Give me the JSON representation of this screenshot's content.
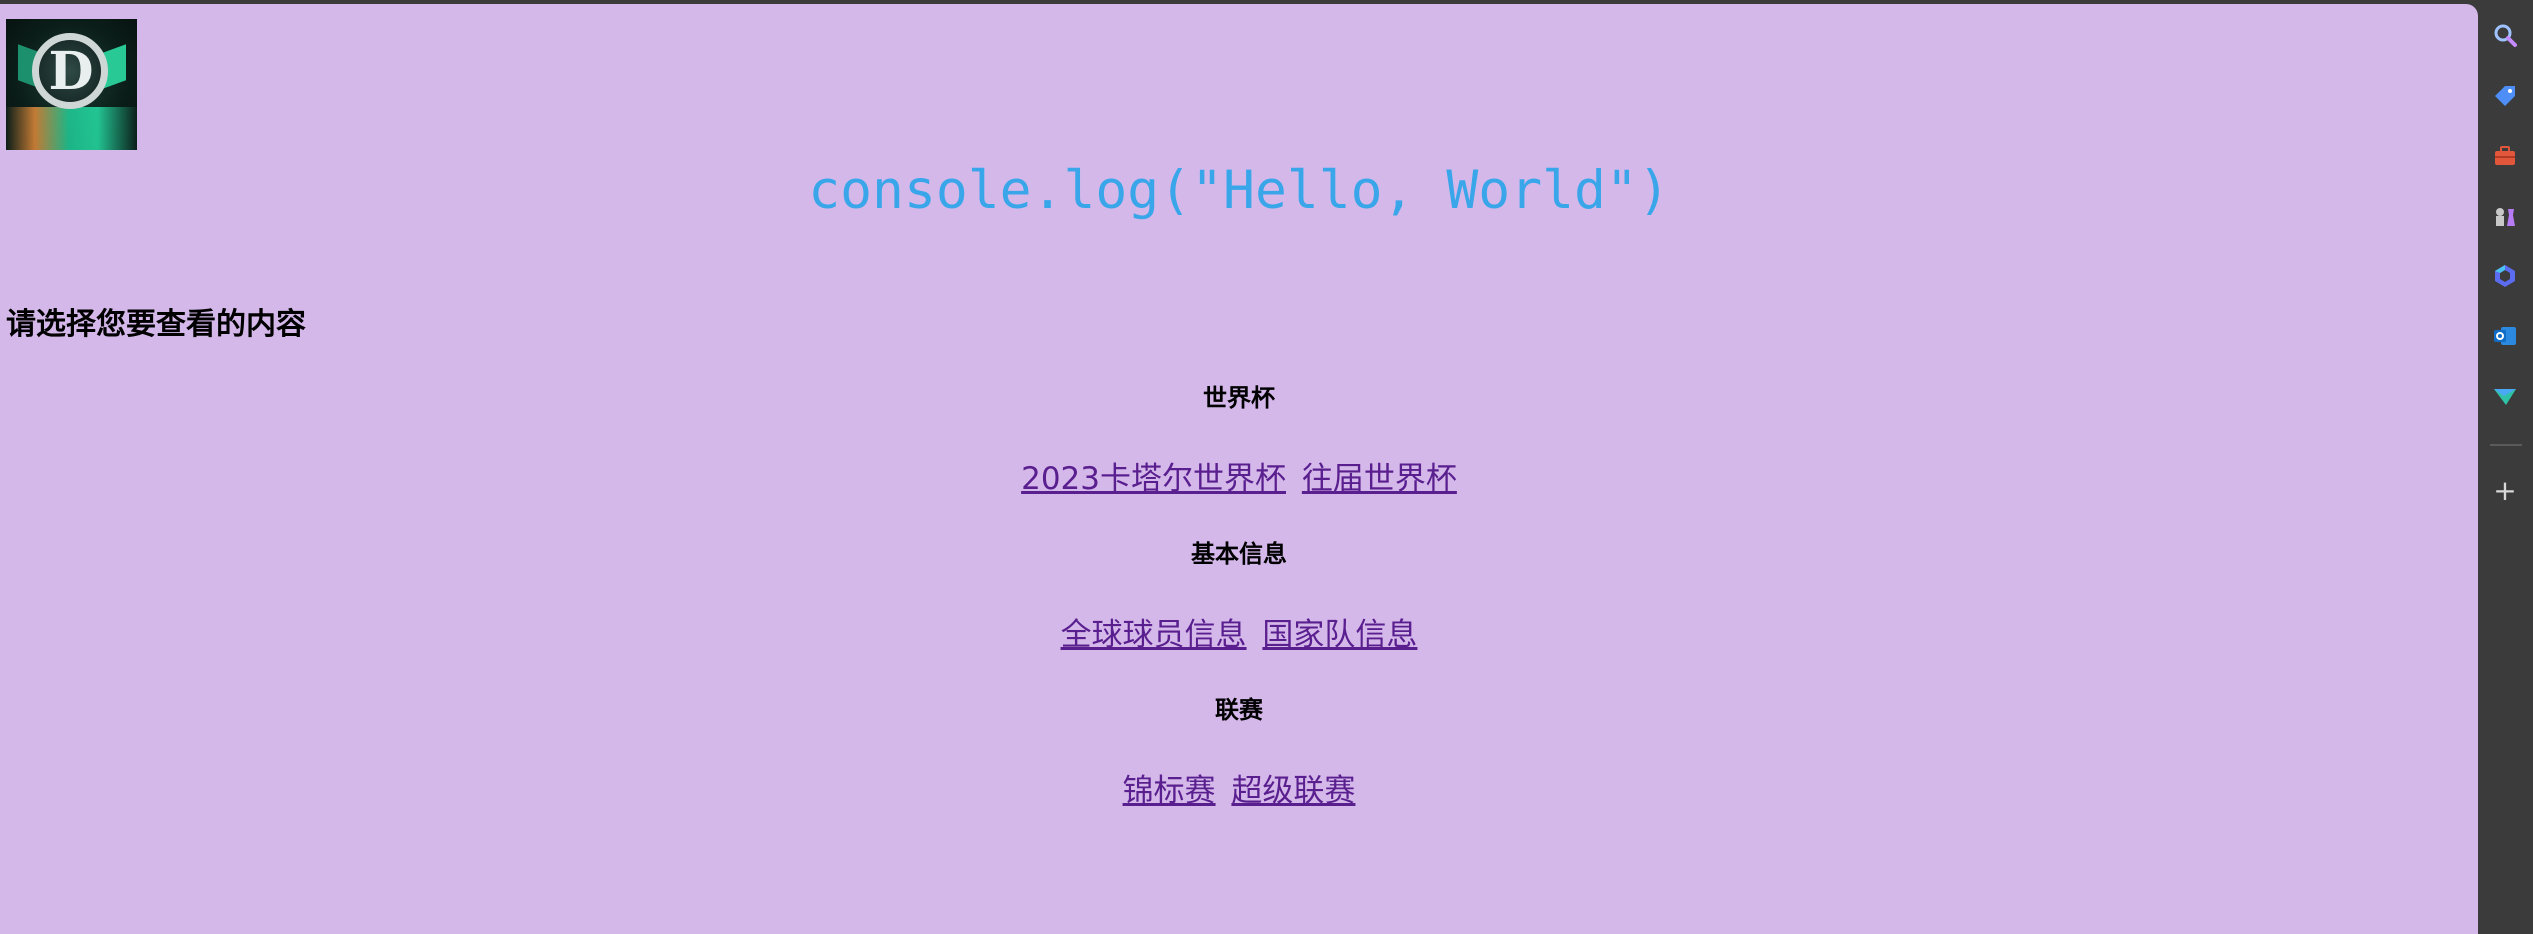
{
  "hero": {
    "code_text": "console.log(\"Hello, World\")"
  },
  "prompt": "请选择您要查看的内容",
  "sections": [
    {
      "title": "世界杯",
      "links": [
        "2023卡塔尔世界杯",
        "往届世界杯"
      ]
    },
    {
      "title": "基本信息",
      "links": [
        "全球球员信息",
        "国家队信息"
      ]
    },
    {
      "title": "联赛",
      "links": [
        "锦标赛",
        "超级联赛"
      ]
    }
  ],
  "sidebar": {
    "icons": [
      "search-icon",
      "tag-icon",
      "briefcase-icon",
      "chess-icon",
      "copilot-icon",
      "outlook-icon",
      "send-icon"
    ],
    "add_label": "+"
  },
  "colors": {
    "page_bg": "#d5b8ea",
    "code_color": "#3aa6ea",
    "link_color": "#5a1f8f",
    "sidebar_bg": "#3b3b3b"
  }
}
